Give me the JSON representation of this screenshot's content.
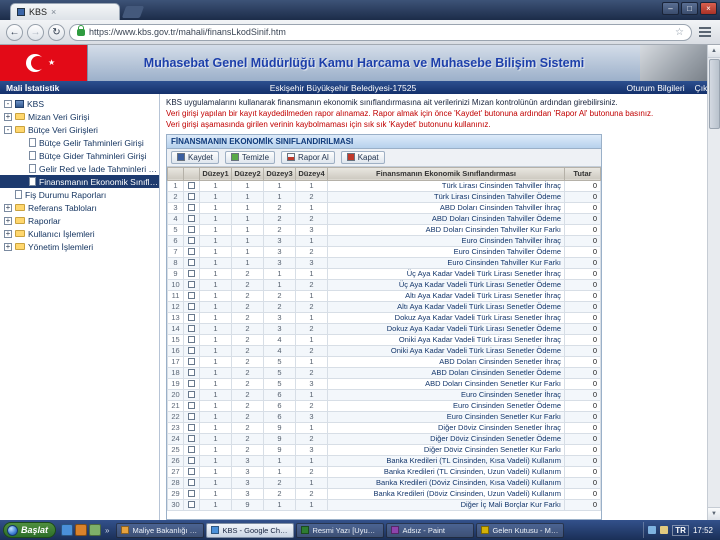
{
  "window": {
    "controls": {
      "minimize": "–",
      "maximize": "□",
      "close": "×"
    }
  },
  "browser": {
    "tab_title": "KBS",
    "back": "←",
    "forward": "→",
    "refresh": "↻",
    "url": "https://www.kbs.gov.tr/mahali/finansLkodSinif.htm",
    "star": "☆",
    "new_tab": "+"
  },
  "banner": {
    "title": "Muhasebat Genel Müdürlüğü Kamu Harcama ve Muhasebe Bilişim Sistemi",
    "flag_star": "★"
  },
  "topbar": {
    "left": "Mali İstatistik",
    "center": "Eskişehir Büyükşehir Belediyesi-17525",
    "links": [
      "Oturum Bilgileri",
      "Çıkış"
    ]
  },
  "sidebar": {
    "items": [
      {
        "label": "KBS",
        "depth": 0,
        "icon": "root",
        "expander": "-"
      },
      {
        "label": "Mizan Veri Girişi",
        "depth": 0,
        "icon": "folder",
        "expander": "+"
      },
      {
        "label": "Bütçe Veri Girişleri",
        "depth": 0,
        "icon": "folder",
        "expander": "-"
      },
      {
        "label": "Bütçe Gelir Tahminleri Girişi",
        "depth": 1,
        "icon": "page"
      },
      {
        "label": "Bütçe Gider Tahminleri Girişi",
        "depth": 1,
        "icon": "page"
      },
      {
        "label": "Gelir Red ve İade Tahminleri Girişi",
        "depth": 1,
        "icon": "page"
      },
      {
        "label": "Finansmanın Ekonomik Sınıflandırması",
        "depth": 1,
        "icon": "page",
        "selected": true
      },
      {
        "label": "Fiş Durumu Raporları",
        "depth": 0,
        "icon": "page"
      },
      {
        "label": "Referans Tabloları",
        "depth": 0,
        "icon": "folder",
        "expander": "+"
      },
      {
        "label": "Raporlar",
        "depth": 0,
        "icon": "folder",
        "expander": "+"
      },
      {
        "label": "Kullanıcı İşlemleri",
        "depth": 0,
        "icon": "folder",
        "expander": "+"
      },
      {
        "label": "Yönetim İşlemleri",
        "depth": 0,
        "icon": "folder",
        "expander": "+"
      }
    ]
  },
  "instructions": {
    "line1": "KBS uygulamalarını kullanarak finansmanın ekonomik sınıflandırmasına ait verilerinizi Mızan kontrolünün ardından girebilirsiniz.",
    "line2": "Veri girişi yapılan bir kayıt kaydedilmeden rapor alınamaz. Rapor almak için önce 'Kaydet' butonuna ardından 'Rapor Al' butonuna basınız.",
    "line3": "Veri girişi aşamasında girilen verinin kaybolmaması için sık sık 'Kaydet' butonunu kullanınız."
  },
  "panel": {
    "title": "FİNANSMANIN EKONOMİK SINIFLANDIRILMASI",
    "toolbar": [
      {
        "label": "Kaydet",
        "icon": "save"
      },
      {
        "label": "Temizle",
        "icon": "clear"
      },
      {
        "label": "Rapor Al",
        "icon": "report"
      },
      {
        "label": "Kapat",
        "icon": "close"
      }
    ]
  },
  "table": {
    "columns": [
      "",
      "",
      "Düzey1",
      "Düzey2",
      "Düzey3",
      "Düzey4",
      "Finansmanın Ekonomik Sınıflandırması",
      "Tutar"
    ],
    "rows": [
      {
        "n": 1,
        "d": [
          1,
          1,
          1,
          1
        ],
        "desc": "Türk Lirası Cinsinden Tahviller İhraç",
        "value": "0"
      },
      {
        "n": 2,
        "d": [
          1,
          1,
          1,
          2
        ],
        "desc": "Türk Lirası Cinsinden Tahviller Ödeme",
        "value": "0"
      },
      {
        "n": 3,
        "d": [
          1,
          1,
          2,
          1
        ],
        "desc": "ABD Doları Cinsinden Tahviller İhraç",
        "value": "0"
      },
      {
        "n": 4,
        "d": [
          1,
          1,
          2,
          2
        ],
        "desc": "ABD Doları Cinsinden Tahviller Ödeme",
        "value": "0"
      },
      {
        "n": 5,
        "d": [
          1,
          1,
          2,
          3
        ],
        "desc": "ABD Doları Cinsinden Tahviller Kur Farkı",
        "value": "0"
      },
      {
        "n": 6,
        "d": [
          1,
          1,
          3,
          1
        ],
        "desc": "Euro Cinsinden Tahviller İhraç",
        "value": "0"
      },
      {
        "n": 7,
        "d": [
          1,
          1,
          3,
          2
        ],
        "desc": "Euro Cinsinden Tahviller Ödeme",
        "value": "0"
      },
      {
        "n": 8,
        "d": [
          1,
          1,
          3,
          3
        ],
        "desc": "Euro Cinsinden Tahviller Kur Farkı",
        "value": "0"
      },
      {
        "n": 9,
        "d": [
          1,
          2,
          1,
          1
        ],
        "desc": "Üç Aya Kadar Vadeli Türk Lirası Senetler İhraç",
        "value": "0"
      },
      {
        "n": 10,
        "d": [
          1,
          2,
          1,
          2
        ],
        "desc": "Üç Aya Kadar Vadeli Türk Lirası Senetler Ödeme",
        "value": "0"
      },
      {
        "n": 11,
        "d": [
          1,
          2,
          2,
          1
        ],
        "desc": "Altı Aya Kadar Vadeli Türk Lirası Senetler İhraç",
        "value": "0"
      },
      {
        "n": 12,
        "d": [
          1,
          2,
          2,
          2
        ],
        "desc": "Altı Aya Kadar Vadeli Türk Lirası Senetler Ödeme",
        "value": "0"
      },
      {
        "n": 13,
        "d": [
          1,
          2,
          3,
          1
        ],
        "desc": "Dokuz Aya Kadar Vadeli Türk Lirası Senetler İhraç",
        "value": "0"
      },
      {
        "n": 14,
        "d": [
          1,
          2,
          3,
          2
        ],
        "desc": "Dokuz Aya Kadar Vadeli Türk Lirası Senetler Ödeme",
        "value": "0"
      },
      {
        "n": 15,
        "d": [
          1,
          2,
          4,
          1
        ],
        "desc": "Oniki Aya Kadar Vadeli Türk Lirası Senetler İhraç",
        "value": "0"
      },
      {
        "n": 16,
        "d": [
          1,
          2,
          4,
          2
        ],
        "desc": "Oniki Aya Kadar Vadeli Türk Lirası Senetler Ödeme",
        "value": "0"
      },
      {
        "n": 17,
        "d": [
          1,
          2,
          5,
          1
        ],
        "desc": "ABD Doları Cinsinden Senetler İhraç",
        "value": "0"
      },
      {
        "n": 18,
        "d": [
          1,
          2,
          5,
          2
        ],
        "desc": "ABD Doları Cinsinden Senetler Ödeme",
        "value": "0"
      },
      {
        "n": 19,
        "d": [
          1,
          2,
          5,
          3
        ],
        "desc": "ABD Doları Cinsinden Senetler Kur Farkı",
        "value": "0"
      },
      {
        "n": 20,
        "d": [
          1,
          2,
          6,
          1
        ],
        "desc": "Euro Cinsinden Senetler İhraç",
        "value": "0"
      },
      {
        "n": 21,
        "d": [
          1,
          2,
          6,
          2
        ],
        "desc": "Euro Cinsinden Senetler Ödeme",
        "value": "0"
      },
      {
        "n": 22,
        "d": [
          1,
          2,
          6,
          3
        ],
        "desc": "Euro Cinsinden Senetler Kur Farkı",
        "value": "0"
      },
      {
        "n": 23,
        "d": [
          1,
          2,
          9,
          1
        ],
        "desc": "Diğer Döviz Cinsinden Senetler İhraç",
        "value": "0"
      },
      {
        "n": 24,
        "d": [
          1,
          2,
          9,
          2
        ],
        "desc": "Diğer Döviz Cinsinden Senetler Ödeme",
        "value": "0"
      },
      {
        "n": 25,
        "d": [
          1,
          2,
          9,
          3
        ],
        "desc": "Diğer Döviz Cinsinden Senetler Kur Farkı",
        "value": "0"
      },
      {
        "n": 26,
        "d": [
          1,
          3,
          1,
          1
        ],
        "desc": "Banka Kredileri (TL Cinsinden, Kısa Vadeli) Kullanım",
        "value": "0"
      },
      {
        "n": 27,
        "d": [
          1,
          3,
          1,
          2
        ],
        "desc": "Banka Kredileri (TL Cinsinden, Uzun Vadeli) Kullanım",
        "value": "0"
      },
      {
        "n": 28,
        "d": [
          1,
          3,
          2,
          1
        ],
        "desc": "Banka Kredileri (Döviz Cinsinden, Kısa Vadeli) Kullanım",
        "value": "0"
      },
      {
        "n": 29,
        "d": [
          1,
          3,
          2,
          2
        ],
        "desc": "Banka Kredileri (Döviz Cinsinden, Uzun Vadeli) Kullanım",
        "value": "0"
      },
      {
        "n": 30,
        "d": [
          1,
          9,
          1,
          1
        ],
        "desc": "Diğer İç Mali Borçlar Kur Farkı",
        "value": "0"
      }
    ]
  },
  "taskbar": {
    "start": "Başlat",
    "overflow": "»",
    "buttons": [
      {
        "label": "Maliye Bakanlığı M...",
        "icon_color": "#e8a33d"
      },
      {
        "label": "KBS - Google Chrome",
        "icon_color": "#4a90d9",
        "active": true
      },
      {
        "label": "Resmi Yazı [Uyumlu...",
        "icon_color": "#2e7d32"
      },
      {
        "label": "Adsız - Paint",
        "icon_color": "#8e44ad"
      },
      {
        "label": "Gelen Kutusu - Mic...",
        "icon_color": "#d4b106"
      }
    ],
    "tray": {
      "lang": "TR",
      "time": "17:52"
    }
  }
}
